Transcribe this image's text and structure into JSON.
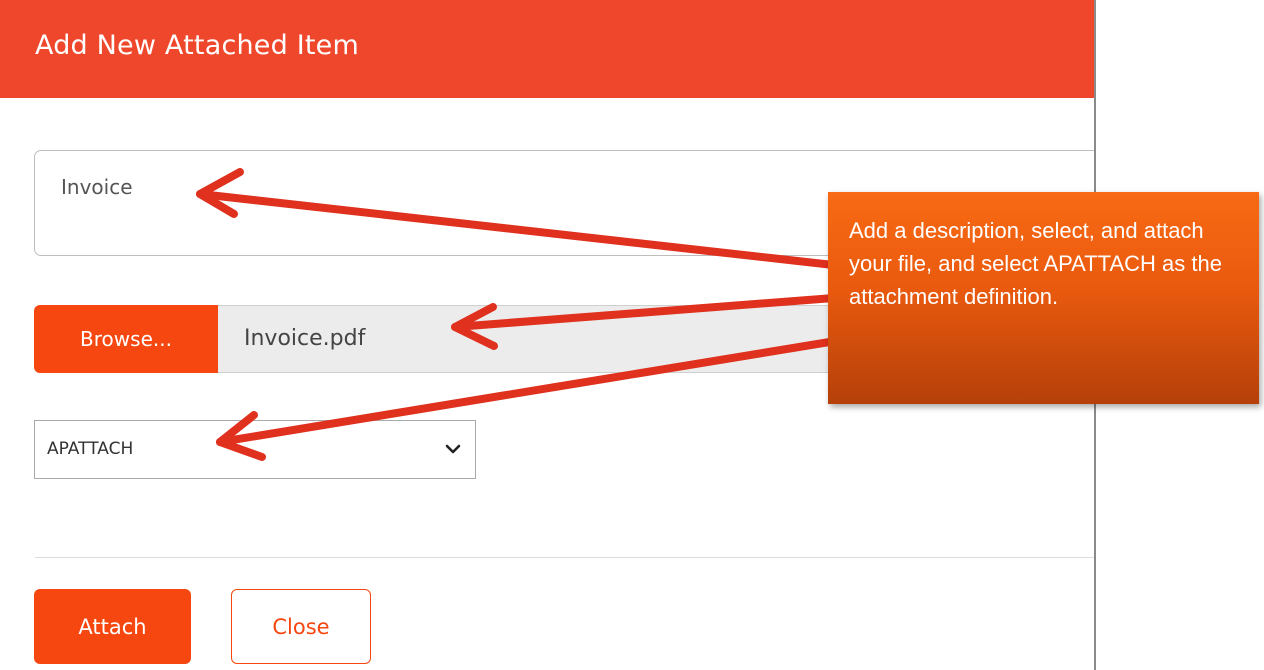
{
  "dialog": {
    "title": "Add New Attached Item",
    "description_value": "Invoice",
    "browse_label": "Browse...",
    "file_name": "Invoice.pdf",
    "definition_selected": "APATTACH",
    "attach_label": "Attach",
    "close_label": "Close"
  },
  "callout": {
    "text": "Add a description, select, and attach your file, and select APATTACH as the attachment definition."
  },
  "colors": {
    "header": "#ef472b",
    "accent": "#f5470f",
    "annotation_arrow": "#e0301e",
    "callout": "#ea5a0e"
  },
  "icons": {
    "select_chevron": "chevron-down-icon",
    "annotation_arrows": "arrow-icon"
  }
}
